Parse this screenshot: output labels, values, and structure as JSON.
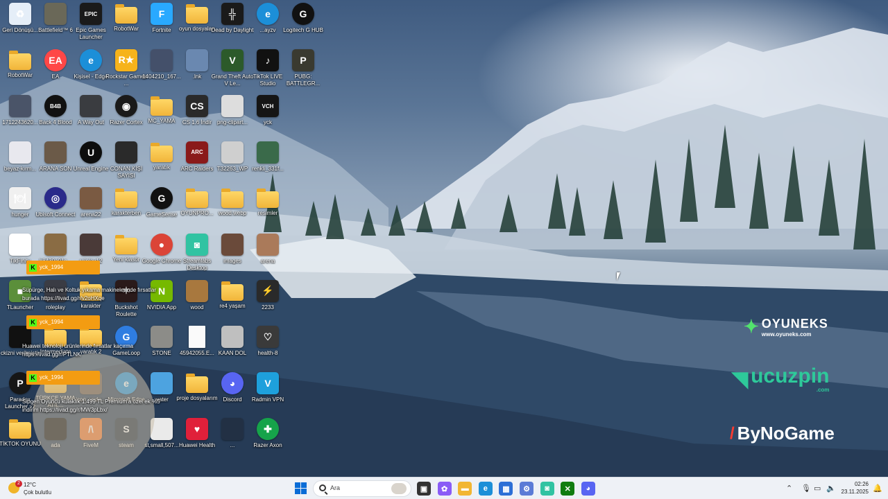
{
  "desktop_icons": [
    {
      "label": "Geri Dönüşü...",
      "icon": "recycle-bin-icon",
      "type": "app",
      "color": "#e5eef8",
      "glyph": "♻"
    },
    {
      "label": "RobotWar",
      "icon": "folder-icon",
      "type": "folder"
    },
    {
      "label": "1712243620...",
      "icon": "image-icon",
      "type": "img",
      "color": "#4a5468"
    },
    {
      "label": "beyaz-kırm...",
      "icon": "image-icon",
      "type": "img",
      "color": "#e8e8ee"
    },
    {
      "label": "hunger",
      "icon": "hunger-icon",
      "type": "app",
      "color": "#f0f0f0",
      "glyph": "🍽"
    },
    {
      "label": "TikFinity",
      "icon": "tikfinity-icon",
      "type": "app",
      "color": "#ffffff",
      "glyph": "TF"
    },
    {
      "label": "TLauncher",
      "icon": "tlauncher-icon",
      "type": "app",
      "color": "#5b8f3a",
      "glyph": "■"
    },
    {
      "label": "ckizni verilmiştir",
      "icon": "video-icon",
      "type": "img",
      "color": "#111111"
    },
    {
      "label": "Paradox Launcher v2",
      "icon": "paradox-launcher-icon",
      "type": "app",
      "color": "#161616",
      "glyph": "P",
      "round": true
    },
    {
      "label": "TİKTOK OYUNU",
      "icon": "folder-icon",
      "type": "folder"
    },
    {
      "label": "Battlefield™ 6",
      "icon": "battlefield-icon",
      "type": "img",
      "color": "#6a6858"
    },
    {
      "label": "EA",
      "icon": "ea-icon",
      "type": "app",
      "color": "#ff4747",
      "glyph": "EA",
      "round": true
    },
    {
      "label": "Back 4 Blood",
      "icon": "back4blood-icon",
      "type": "app",
      "color": "#111111",
      "glyph": "B4B",
      "round": true
    },
    {
      "label": "ARANA SON",
      "icon": "image-icon",
      "type": "img",
      "color": "#6b5a48"
    },
    {
      "label": "Ubisoft Connect",
      "icon": "ubisoft-icon",
      "type": "app",
      "color": "#2a2a8a",
      "glyph": "◎",
      "round": true
    },
    {
      "label": "b8430a91c...",
      "icon": "conan-icon",
      "type": "img",
      "color": "#8a6c44"
    },
    {
      "label": "roleplay",
      "icon": "image-icon",
      "type": "img",
      "color": "#3a3c44"
    },
    {
      "label": "Intermediate",
      "icon": "folder-icon",
      "type": "folder"
    },
    {
      "label": "TÜRKÇE YAMA ATIL...",
      "icon": "folder-icon",
      "type": "folder"
    },
    {
      "label": "ada",
      "icon": "image-icon",
      "type": "img",
      "color": "#0a0a0a"
    },
    {
      "label": "Epic Games Launcher",
      "icon": "epic-games-icon",
      "type": "app",
      "color": "#1a1a1a",
      "glyph": "EPIC"
    },
    {
      "label": "Kişisel - Edge",
      "icon": "edge-icon",
      "type": "app",
      "color": "#1c8fd8",
      "glyph": "e",
      "round": true
    },
    {
      "label": "A Way Out",
      "icon": "a-way-out-icon",
      "type": "img",
      "color": "#3a3c40"
    },
    {
      "label": "Unreal Engine",
      "icon": "unreal-icon",
      "type": "app",
      "color": "#0d0d0d",
      "glyph": "U",
      "round": true
    },
    {
      "label": "arena22",
      "icon": "image-icon",
      "type": "img",
      "color": "#7a5a42"
    },
    {
      "label": "rolplay12",
      "icon": "image-icon",
      "type": "img",
      "color": "#4a3a38"
    },
    {
      "label": "karakter",
      "icon": "folder-icon",
      "type": "folder"
    },
    {
      "label": "yaratık 2",
      "icon": "folder-icon",
      "type": "folder"
    },
    {
      "label": "icon_unde...",
      "icon": "image-icon",
      "type": "img",
      "color": "#6a5848"
    },
    {
      "label": "FiveM",
      "icon": "fivem-icon",
      "type": "app",
      "color": "#f4762a",
      "glyph": "/\\"
    },
    {
      "label": "RobotWar",
      "icon": "folder-icon",
      "type": "folder"
    },
    {
      "label": "Rockstar Games ...",
      "icon": "rockstar-icon",
      "type": "app",
      "color": "#f6b31b",
      "glyph": "R★"
    },
    {
      "label": "Razer Cortex",
      "icon": "razer-cortex-icon",
      "type": "app",
      "color": "#1a1a1a",
      "glyph": "◉",
      "round": true
    },
    {
      "label": "CONAN KİŞİ SAYISI",
      "icon": "image-icon",
      "type": "img",
      "color": "#2a2a2a"
    },
    {
      "label": "karakterben",
      "icon": "folder-icon",
      "type": "folder"
    },
    {
      "label": "Yeni klasör",
      "icon": "folder-icon",
      "type": "folder"
    },
    {
      "label": "Buckshot Roulette",
      "icon": "buckshot-icon",
      "type": "app",
      "color": "#2a1a1a",
      "glyph": "✶"
    },
    {
      "label": "GameLoop",
      "icon": "gameloop-icon",
      "type": "app",
      "color": "#2f7de1",
      "glyph": "G",
      "round": true
    },
    {
      "label": "Microsoft Edge",
      "icon": "edge-icon",
      "type": "app",
      "color": "#1c8fd8",
      "glyph": "e",
      "round": true
    },
    {
      "label": "steam",
      "icon": "steam-icon",
      "type": "app",
      "color": "#1b2838",
      "glyph": "S"
    },
    {
      "label": "Fortnite",
      "icon": "fortnite-icon",
      "type": "app",
      "color": "#29a9ff",
      "glyph": "F"
    },
    {
      "label": "1404210_167...",
      "icon": "image-icon",
      "type": "img",
      "color": "#44506a"
    },
    {
      "label": "MC_YAMA",
      "icon": "folder-icon",
      "type": "folder"
    },
    {
      "label": "yaratık",
      "icon": "folder-icon",
      "type": "folder"
    },
    {
      "label": "GameSense",
      "icon": "gamesense-icon",
      "type": "app",
      "color": "#111111",
      "glyph": "G",
      "round": true
    },
    {
      "label": "Google Chrome",
      "icon": "chrome-icon",
      "type": "app",
      "color": "#db4437",
      "glyph": "●",
      "round": true
    },
    {
      "label": "NVIDIA App",
      "icon": "nvidia-icon",
      "type": "app",
      "color": "#76b900",
      "glyph": "N"
    },
    {
      "label": "STONE",
      "icon": "image-icon",
      "type": "img",
      "color": "#8c8c88"
    },
    {
      "label": "water",
      "icon": "image-icon",
      "type": "img",
      "color": "#4da3e0"
    },
    {
      "label": "st,small,507...",
      "icon": "image-icon",
      "type": "img",
      "color": "#eaeaea"
    },
    {
      "label": "oyun dosyaları",
      "icon": "folder-icon",
      "type": "folder"
    },
    {
      "label": ".lnk",
      "icon": "shortcut-icon",
      "type": "img",
      "color": "#6a88b0"
    },
    {
      "label": "CS 1.6 İndir",
      "icon": "cs16-icon",
      "type": "app",
      "color": "#2a2a2a",
      "glyph": "CS"
    },
    {
      "label": "ARC Raiders",
      "icon": "arc-raiders-icon",
      "type": "app",
      "color": "#8a1a1a",
      "glyph": "ARC"
    },
    {
      "label": "OYUNPRO...",
      "icon": "folder-icon",
      "type": "folder"
    },
    {
      "label": "Streamlabs Desktop",
      "icon": "streamlabs-icon",
      "type": "app",
      "color": "#31c3a2",
      "glyph": "◙"
    },
    {
      "label": "wood",
      "icon": "image-icon",
      "type": "img",
      "color": "#a8783e"
    },
    {
      "label": "45942055.E...",
      "icon": "file-icon",
      "type": "page"
    },
    {
      "label": "proje dosyalarım",
      "icon": "folder-icon",
      "type": "folder"
    },
    {
      "label": "Huawei Health",
      "icon": "heart-icon",
      "type": "app",
      "color": "#e0203a",
      "glyph": "♥"
    },
    {
      "label": "Dead by Daylight",
      "icon": "dead-by-daylight-icon",
      "type": "app",
      "color": "#1a1a1a",
      "glyph": "╬"
    },
    {
      "label": "Grand Theft Auto V Le...",
      "icon": "gta5-icon",
      "type": "app",
      "color": "#2c5a2a",
      "glyph": "V"
    },
    {
      "label": "png-clipart...",
      "icon": "image-icon",
      "type": "img",
      "color": "#dddddd"
    },
    {
      "label": "T32263_WP",
      "icon": "image-icon",
      "type": "img",
      "color": "#cfcfcf"
    },
    {
      "label": "wood.webp",
      "icon": "folder-icon",
      "type": "folder"
    },
    {
      "label": "images",
      "icon": "image-icon",
      "type": "img",
      "color": "#6a4a3a"
    },
    {
      "label": "re4 yaşam",
      "icon": "folder-icon",
      "type": "folder"
    },
    {
      "label": "KAAN DOL",
      "icon": "image-icon",
      "type": "img",
      "color": "#bfbfbf"
    },
    {
      "label": "Discord",
      "icon": "discord-icon",
      "type": "app",
      "color": "#5865f2",
      "glyph": "◕",
      "round": true
    },
    {
      "label": "...",
      "icon": "image-icon",
      "type": "img",
      "color": "#223044"
    },
    {
      "label": "...ayzv",
      "icon": "edge-icon",
      "type": "app",
      "color": "#1c8fd8",
      "glyph": "e",
      "round": true
    },
    {
      "label": "TikTok LIVE Studio",
      "icon": "tiktok-live-icon",
      "type": "app",
      "color": "#111111",
      "glyph": "♪"
    },
    {
      "label": "yck",
      "icon": "vch-icon",
      "type": "app",
      "color": "#151515",
      "glyph": "VCH"
    },
    {
      "label": "renkli_331f...",
      "icon": "image-icon",
      "type": "img",
      "color": "#3a6a4a"
    },
    {
      "label": "resimler",
      "icon": "folder-icon",
      "type": "folder"
    },
    {
      "label": "arena",
      "icon": "image-icon",
      "type": "img",
      "color": "#aa7a5a"
    },
    {
      "label": "2233",
      "icon": "lightning-icon",
      "type": "app",
      "color": "#2a2a2a",
      "glyph": "⚡"
    },
    {
      "label": "health-8",
      "icon": "heart-outline-icon",
      "type": "app",
      "color": "#3a3a3a",
      "glyph": "♡"
    },
    {
      "label": "Radmin VPN",
      "icon": "radmin-vpn-icon",
      "type": "app",
      "color": "#1ea0dc",
      "glyph": "V"
    },
    {
      "label": "Razer Axon",
      "icon": "razer-axon-icon",
      "type": "app",
      "color": "#16a34a",
      "glyph": "✚",
      "round": true
    },
    {
      "label": "Logitech G HUB",
      "icon": "logitech-icon",
      "type": "app",
      "color": "#111111",
      "glyph": "G",
      "round": true
    },
    {
      "label": "PUBG: BATTLEGR...",
      "icon": "pubg-icon",
      "type": "app",
      "color": "#3a3a30",
      "glyph": "P"
    }
  ],
  "chat": {
    "username": "yck_1994",
    "messages": [
      "Süpürge, Halı ve Koltuk yıkama makinelerinde fırsatlar burada https://livad.gg/r/v2oHXqe",
      "Huawei teknoloji ürünlerinde fırsatlar kaçırma https://livad.gg/r/PTLNK",
      "Sipgen Oyuncu kulaklık 1.499 TL Premium'a özel ek %5 indirim https://livad.gg/r/MW3pLbx/"
    ]
  },
  "sponsors": {
    "oyuneks": "OYUNEKS",
    "oyuneks_url": "www.oyuneks.com",
    "ucuzpin": "ucuzpin",
    "ucuzpin_url": ".com",
    "bynogame": "ByNoGame"
  },
  "taskbar": {
    "weather_temp": "12°C",
    "weather_desc": "Çok bulutlu",
    "weather_badge": "2",
    "search_placeholder": "Ara",
    "time": "02:26",
    "date": "23.11.2025",
    "pinned": [
      {
        "name": "task-view-icon",
        "color": "#333333",
        "glyph": "▣"
      },
      {
        "name": "copilot-icon",
        "color": "#8a5cf6",
        "glyph": "✿"
      },
      {
        "name": "file-explorer-icon",
        "color": "#f2b632",
        "glyph": "▬"
      },
      {
        "name": "edge-icon",
        "color": "#1c8fd8",
        "glyph": "e"
      },
      {
        "name": "microsoft-store-icon",
        "color": "#2c6fd6",
        "glyph": "▦"
      },
      {
        "name": "settings-icon",
        "color": "#5b7bd6",
        "glyph": "⚙"
      },
      {
        "name": "streamlabs-icon",
        "color": "#31c3a2",
        "glyph": "◙"
      },
      {
        "name": "xbox-icon",
        "color": "#107c10",
        "glyph": "✕"
      },
      {
        "name": "discord-icon",
        "color": "#5865f2",
        "glyph": "◕"
      }
    ]
  }
}
